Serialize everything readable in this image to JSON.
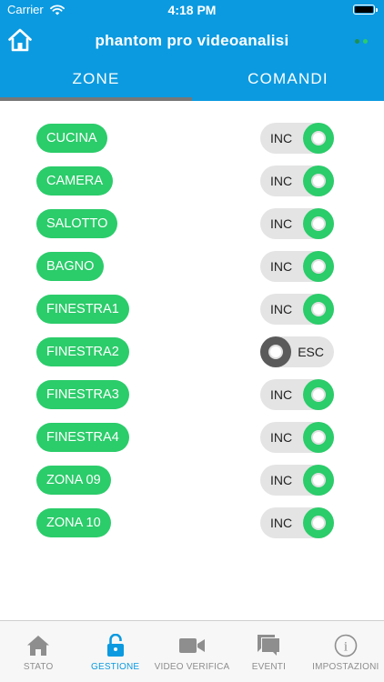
{
  "status_bar": {
    "carrier": "Carrier",
    "time": "4:18 PM"
  },
  "header": {
    "title": "phantom pro videoanalisi",
    "connection_dot_colors": [
      "#1f8f50",
      "#2bcc6a"
    ]
  },
  "tabs": [
    {
      "label": "ZONE",
      "active": true
    },
    {
      "label": "COMANDI",
      "active": false
    }
  ],
  "zones": [
    {
      "name": "CUCINA",
      "state": "INC",
      "on": true
    },
    {
      "name": "CAMERA",
      "state": "INC",
      "on": true
    },
    {
      "name": "SALOTTO",
      "state": "INC",
      "on": true
    },
    {
      "name": "BAGNO",
      "state": "INC",
      "on": true
    },
    {
      "name": "FINESTRA1",
      "state": "INC",
      "on": true
    },
    {
      "name": "FINESTRA2",
      "state": "ESC",
      "on": false
    },
    {
      "name": "FINESTRA3",
      "state": "INC",
      "on": true
    },
    {
      "name": "FINESTRA4",
      "state": "INC",
      "on": true
    },
    {
      "name": "ZONA 09",
      "state": "INC",
      "on": true
    },
    {
      "name": "ZONA 10",
      "state": "INC",
      "on": true
    }
  ],
  "bottom_tabs": [
    {
      "label": "STATO",
      "icon": "home-icon",
      "active": false
    },
    {
      "label": "GESTIONE",
      "icon": "lock-icon",
      "active": true
    },
    {
      "label": "VIDEO VERIFICA",
      "icon": "video-camera-icon",
      "active": false
    },
    {
      "label": "EVENTI",
      "icon": "chat-bubbles-icon",
      "active": false
    },
    {
      "label": "IMPOSTAZIONI",
      "icon": "info-icon",
      "active": false
    }
  ],
  "colors": {
    "primary": "#0b9ae0",
    "green": "#2bcc6a",
    "knob_off": "#5a5a5a",
    "tab_inactive": "#8e8e8e"
  }
}
